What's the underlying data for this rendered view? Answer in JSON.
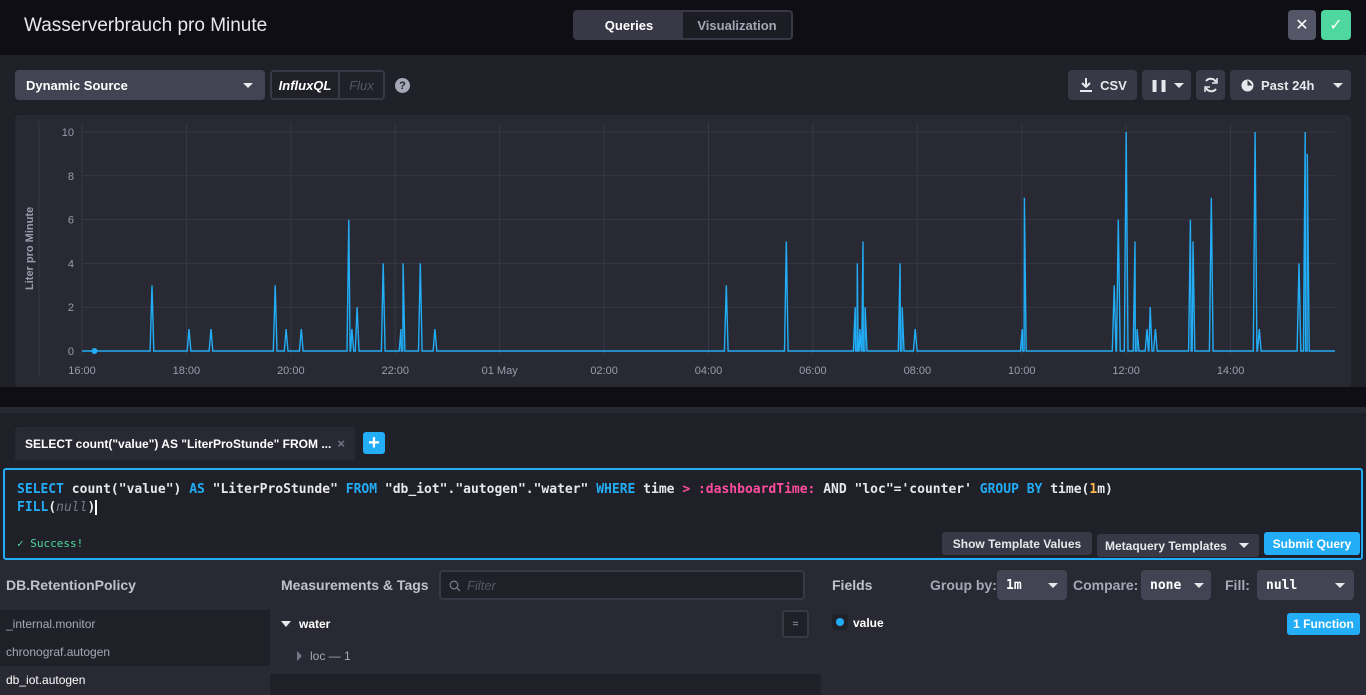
{
  "header": {
    "title": "Wasserverbrauch pro Minute",
    "tabs": [
      {
        "label": "Queries",
        "active": true
      },
      {
        "label": "Visualization",
        "active": false
      }
    ],
    "close_icon": "close-icon",
    "confirm_icon": "check-icon"
  },
  "toolbar": {
    "source": "Dynamic Source",
    "languages": [
      "InfluxQL",
      "Flux"
    ],
    "active_language": "InfluxQL",
    "help": "?",
    "csv_label": "CSV",
    "pause_icon": "pause-icon",
    "refresh_icon": "refresh-icon",
    "time_range": "Past 24h"
  },
  "colors": {
    "accent": "#22adf6",
    "success": "#4ed8a0",
    "series": "#22adf6",
    "template_var": "#ff4d9e"
  },
  "chart_data": {
    "type": "line",
    "title": "",
    "xlabel": "",
    "ylabel": "Liter pro Minute",
    "x_unit": "hours since 30 Apr 16:00",
    "xlim": [
      0,
      24
    ],
    "ylim": [
      0,
      10.2
    ],
    "x_ticks": [
      {
        "at": 0,
        "label": "16:00"
      },
      {
        "at": 2,
        "label": "18:00"
      },
      {
        "at": 4,
        "label": "20:00"
      },
      {
        "at": 6,
        "label": "22:00"
      },
      {
        "at": 8,
        "label": "01 May"
      },
      {
        "at": 10,
        "label": "02:00"
      },
      {
        "at": 12,
        "label": "04:00"
      },
      {
        "at": 14,
        "label": "06:00"
      },
      {
        "at": 16,
        "label": "08:00"
      },
      {
        "at": 18,
        "label": "10:00"
      },
      {
        "at": 20,
        "label": "12:00"
      },
      {
        "at": 22,
        "label": "14:00"
      }
    ],
    "y_ticks": [
      0,
      2,
      4,
      6,
      8,
      10
    ],
    "grid": true,
    "legend": "none",
    "baseline": 0,
    "marker_point": {
      "x": 0.24,
      "y": 0
    },
    "series": [
      {
        "name": "LiterProStunde",
        "spikes": [
          [
            1.34,
            3
          ],
          [
            2.05,
            1
          ],
          [
            2.47,
            1
          ],
          [
            3.7,
            3
          ],
          [
            3.91,
            1
          ],
          [
            4.2,
            1
          ],
          [
            5.11,
            6
          ],
          [
            5.17,
            1
          ],
          [
            5.27,
            2
          ],
          [
            5.77,
            4
          ],
          [
            6.11,
            1
          ],
          [
            6.15,
            4
          ],
          [
            6.48,
            4
          ],
          [
            6.76,
            1
          ],
          [
            12.34,
            3
          ],
          [
            13.49,
            5
          ],
          [
            14.81,
            2
          ],
          [
            14.85,
            4
          ],
          [
            14.9,
            1
          ],
          [
            14.96,
            5
          ],
          [
            15.0,
            2
          ],
          [
            15.67,
            4
          ],
          [
            15.71,
            2
          ],
          [
            15.96,
            1
          ],
          [
            18.01,
            1
          ],
          [
            18.05,
            7
          ],
          [
            18.08,
            1
          ],
          [
            19.77,
            3
          ],
          [
            19.85,
            6
          ],
          [
            20.0,
            10
          ],
          [
            20.17,
            5
          ],
          [
            20.21,
            1
          ],
          [
            20.4,
            1
          ],
          [
            20.46,
            2
          ],
          [
            20.56,
            1
          ],
          [
            21.23,
            6
          ],
          [
            21.28,
            5
          ],
          [
            21.63,
            7
          ],
          [
            22.47,
            10
          ],
          [
            22.55,
            1
          ],
          [
            23.31,
            4
          ],
          [
            23.43,
            10
          ],
          [
            23.47,
            9
          ]
        ]
      }
    ]
  },
  "query_tabs": [
    {
      "label": "SELECT count(\"value\") AS \"LiterProStunde\" FROM ...",
      "close": "×"
    }
  ],
  "add_query": "+",
  "editor": {
    "tokens": {
      "select": "SELECT",
      "count": " count(\"value\") ",
      "as": "AS",
      "alias": " \"LiterProStunde\" ",
      "from": "FROM",
      "source": " \"db_iot\".\"autogen\".\"water\" ",
      "where": "WHERE",
      "time": " time ",
      "gt": ">",
      "sp": " ",
      "dash": ":dashboardTime:",
      "and": " AND \"loc\"='counter' ",
      "group": "GROUP BY",
      "timefn": " time(",
      "one": "1",
      "m": "m)",
      "fill": "FILL",
      "lp": "(",
      "null": "null",
      "rp": ")"
    },
    "status": "Success!",
    "show_template_values": "Show Template Values",
    "metaquery_templates": "Metaquery Templates",
    "submit": "Submit Query"
  },
  "builder": {
    "db_header": "DB.RetentionPolicy",
    "databases": [
      "_internal.monitor",
      "chronograf.autogen",
      "db_iot.autogen"
    ],
    "selected_db": "db_iot.autogen",
    "measurements_header": "Measurements & Tags",
    "filter_placeholder": "Filter",
    "measurement": "water",
    "tag": "loc — 1",
    "eq_button": "=",
    "fields_header": "Fields",
    "group_by_label": "Group by:",
    "group_by_value": "1m",
    "compare_label": "Compare:",
    "compare_value": "none",
    "fill_label": "Fill:",
    "fill_value": "null",
    "field": "value",
    "function_button": "1 Function"
  }
}
